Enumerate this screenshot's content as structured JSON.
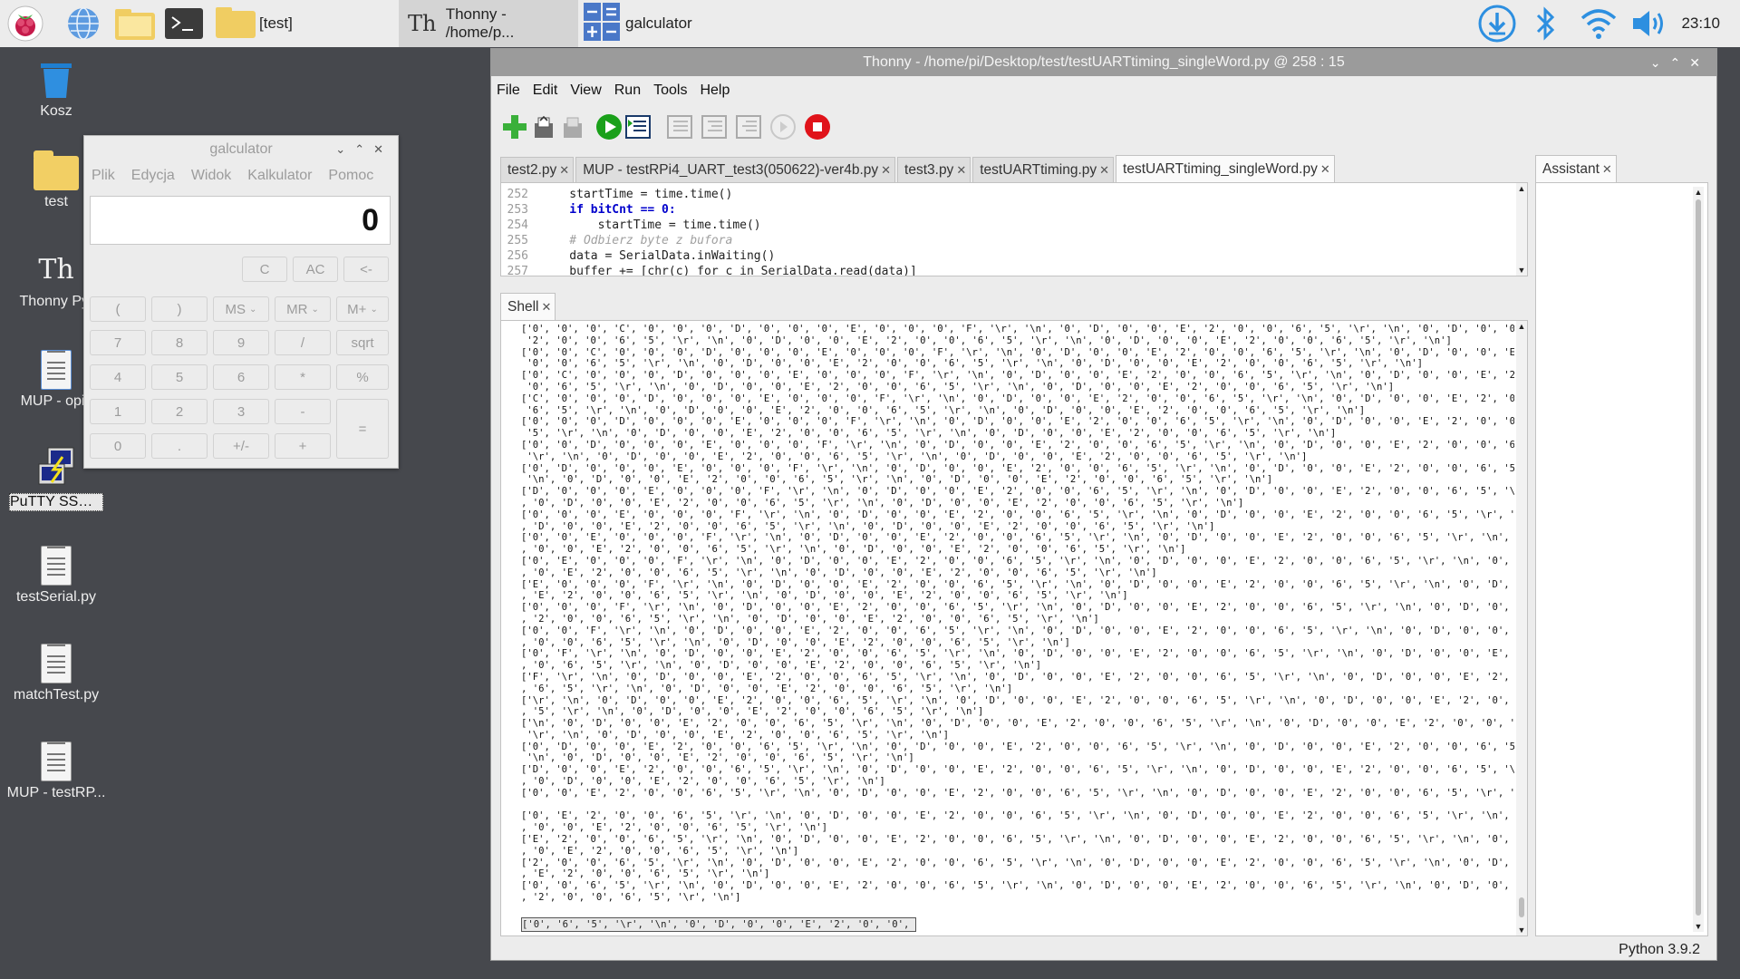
{
  "taskbar": {
    "tasks": [
      {
        "label": "[test]"
      },
      {
        "label": "Thonny  -  /home/p..."
      },
      {
        "label": "galculator"
      }
    ],
    "clock": "23:10",
    "icons": [
      "raspberry-menu-icon",
      "browser-globe-icon",
      "file-manager-icon",
      "terminal-icon",
      "folder-icon",
      "download-icon",
      "bluetooth-icon",
      "wifi-icon",
      "volume-icon"
    ]
  },
  "desktop": {
    "icons": [
      {
        "label": "Kosz",
        "icon": "trash-icon"
      },
      {
        "label": "test",
        "icon": "folder-icon"
      },
      {
        "label": "Thonny Pyt",
        "icon": "thonny-icon"
      },
      {
        "label": "MUP - opis",
        "icon": "document-icon"
      },
      {
        "label": "PuTTY SSH ...",
        "icon": "putty-icon"
      },
      {
        "label": "testSerial.py",
        "icon": "file-icon"
      },
      {
        "label": "matchTest.py",
        "icon": "file-icon"
      },
      {
        "label": "MUP - testRP...",
        "icon": "file-icon"
      }
    ]
  },
  "calculator": {
    "title": "galculator",
    "menu": [
      "Plik",
      "Edycja",
      "Widok",
      "Kalkulator",
      "Pomoc"
    ],
    "display": "0",
    "top_buttons": [
      "C",
      "AC",
      "<-"
    ],
    "rows": [
      [
        "(",
        ")",
        "MS",
        "MR",
        "M+"
      ],
      [
        "7",
        "8",
        "9",
        "/",
        "sqrt"
      ],
      [
        "4",
        "5",
        "6",
        "*",
        "%"
      ],
      [
        "1",
        "2",
        "3",
        "-",
        "="
      ],
      [
        "0",
        ".",
        "+/-",
        "+"
      ]
    ]
  },
  "thonny": {
    "title": "Thonny  -  /home/pi/Desktop/test/testUARTtiming_singleWord.py  @  258 : 15",
    "menu": [
      "File",
      "Edit",
      "View",
      "Run",
      "Tools",
      "Help"
    ],
    "toolbar": [
      "new-file",
      "open-file",
      "save-file",
      "run",
      "debug",
      "step-over",
      "step-into",
      "step-out",
      "resume",
      "stop"
    ],
    "editor_tabs": [
      {
        "label": "test2.py"
      },
      {
        "label": "MUP - testRPi4_UART_test3(050622)-ver4b.py"
      },
      {
        "label": "test3.py"
      },
      {
        "label": "testUARTtiming.py"
      },
      {
        "label": "testUARTtiming_singleWord.py",
        "active": true
      }
    ],
    "assistant_tab": "Assistant",
    "shell_tab": "Shell",
    "code": [
      {
        "n": "252",
        "text": "    startTime = time.time()"
      },
      {
        "n": "253",
        "text": "    if bitCnt == 0:"
      },
      {
        "n": "254",
        "text": "        startTime = time.time()"
      },
      {
        "n": "255",
        "text": "    # Odbierz byte z bufora"
      },
      {
        "n": "256",
        "text": "    data = SerialData.inWaiting()"
      },
      {
        "n": "257",
        "text": "    buffer += [chr(c) for c in SerialData.read(data)]"
      }
    ],
    "shell_lines": [
      "['0', '0', '0', 'C', '0', '0', '0', 'D', '0', '0', '0', 'E', '0', '0', '0', 'F', '\\r', '\\n', '0', 'D', '0', '0', 'E', '2', '0', '0', '6', '5', '\\r', '\\n', '0', 'D', '0', '0', 'E',",
      " '2', '0', '0', '6', '5', '\\r', '\\n', '0', 'D', '0', '0', 'E', '2', '0', '0', '6', '5', '\\r', '\\n', '0', 'D', '0', '0', 'E', '2', '0', '0', '6', '5', '\\r', '\\n']",
      "['0', '0', 'C', '0', '0', '0', 'D', '0', '0', '0', 'E', '0', '0', '0', 'F', '\\r', '\\n', '0', 'D', '0', '0', 'E', '2', '0', '0', '6', '5', '\\r', '\\n', '0', 'D', '0', '0', 'E', '2',",
      " '0', '0', '6', '5', '\\r', '\\n', '0', 'D', '0', '0', 'E', '2', '0', '0', '6', '5', '\\r', '\\n', '0', 'D', '0', '0', 'E', '2', '0', '0', '6', '5', '\\r', '\\n']",
      "['0', 'C', '0', '0', '0', 'D', '0', '0', '0', 'E', '0', '0', '0', 'F', '\\r', '\\n', '0', 'D', '0', '0', 'E', '2', '0', '0', '6', '5', '\\r', '\\n', '0', 'D', '0', '0', 'E', '2', '0',",
      " '0', '6', '5', '\\r', '\\n', '0', 'D', '0', '0', 'E', '2', '0', '0', '6', '5', '\\r', '\\n', '0', 'D', '0', '0', 'E', '2', '0', '0', '6', '5', '\\r', '\\n']",
      "['C', '0', '0', '0', 'D', '0', '0', '0', 'E', '0', '0', '0', 'F', '\\r', '\\n', '0', 'D', '0', '0', 'E', '2', '0', '0', '6', '5', '\\r', '\\n', '0', 'D', '0', '0', 'E', '2', '0', '0',",
      " '6', '5', '\\r', '\\n', '0', 'D', '0', '0', 'E', '2', '0', '0', '6', '5', '\\r', '\\n', '0', 'D', '0', '0', 'E', '2', '0', '0', '6', '5', '\\r', '\\n']",
      "['0', '0', '0', 'D', '0', '0', '0', 'E', '0', '0', '0', 'F', '\\r', '\\n', '0', 'D', '0', '0', 'E', '2', '0', '0', '6', '5', '\\r', '\\n', '0', 'D', '0', '0', 'E', '2', '0', '0', '6',",
      " '5', '\\r', '\\n', '0', 'D', '0', '0', 'E', '2', '0', '0', '6', '5', '\\r', '\\n', '0', 'D', '0', '0', 'E', '2', '0', '0', '6', '5', '\\r', '\\n']",
      "['0', '0', 'D', '0', '0', '0', 'E', '0', '0', '0', 'F', '\\r', '\\n', '0', 'D', '0', '0', 'E', '2', '0', '0', '6', '5', '\\r', '\\n', '0', 'D', '0', '0', 'E', '2', '0', '0', '6', '5',",
      " '\\r', '\\n', '0', 'D', '0', '0', 'E', '2', '0', '0', '6', '5', '\\r', '\\n', '0', 'D', '0', '0', 'E', '2', '0', '0', '6', '5', '\\r', '\\n']",
      "['0', 'D', '0', '0', '0', 'E', '0', '0', '0', 'F', '\\r', '\\n', '0', 'D', '0', '0', 'E', '2', '0', '0', '6', '5', '\\r', '\\n', '0', 'D', '0', '0', 'E', '2', '0', '0', '6', '5', '\\r',",
      " '\\n', '0', 'D', '0', '0', 'E', '2', '0', '0', '6', '5', '\\r', '\\n', '0', 'D', '0', '0', 'E', '2', '0', '0', '6', '5', '\\r', '\\n']",
      "['D', '0', '0', '0', 'E', '0', '0', '0', 'F', '\\r', '\\n', '0', 'D', '0', '0', 'E', '2', '0', '0', '6', '5', '\\r', '\\n', '0', 'D', '0', '0', 'E', '2', '0', '0', '6', '5', '\\r', '\\n'",
      ", '0', 'D', '0', '0', 'E', '2', '0', '0', '6', '5', '\\r', '\\n', '0', 'D', '0', '0', 'E', '2', '0', '0', '6', '5', '\\r', '\\n']",
      "['0', '0', '0', 'E', '0', '0', '0', 'F', '\\r', '\\n', '0', 'D', '0', '0', 'E', '2', '0', '0', '6', '5', '\\r', '\\n', '0', 'D', '0', '0', 'E', '2', '0', '0', '6', '5', '\\r', '\\n', '0'",
      ", 'D', '0', '0', 'E', '2', '0', '0', '6', '5', '\\r', '\\n', '0', 'D', '0', '0', 'E', '2', '0', '0', '6', '5', '\\r', '\\n']",
      "['0', '0', 'E', '0', '0', '0', 'F', '\\r', '\\n', '0', 'D', '0', '0', 'E', '2', '0', '0', '6', '5', '\\r', '\\n', '0', 'D', '0', '0', 'E', '2', '0', '0', '6', '5', '\\r', '\\n', '0', 'D'",
      ", '0', '0', 'E', '2', '0', '0', '6', '5', '\\r', '\\n', '0', 'D', '0', '0', 'E', '2', '0', '0', '6', '5', '\\r', '\\n']",
      "['0', 'E', '0', '0', '0', 'F', '\\r', '\\n', '0', 'D', '0', '0', 'E', '2', '0', '0', '6', '5', '\\r', '\\n', '0', 'D', '0', '0', 'E', '2', '0', '0', '6', '5', '\\r', '\\n', '0', 'D', '0'",
      ", '0', 'E', '2', '0', '0', '6', '5', '\\r', '\\n', '0', 'D', '0', '0', 'E', '2', '0', '0', '6', '5', '\\r', '\\n']",
      "['E', '0', '0', '0', 'F', '\\r', '\\n', '0', 'D', '0', '0', 'E', '2', '0', '0', '6', '5', '\\r', '\\n', '0', 'D', '0', '0', 'E', '2', '0', '0', '6', '5', '\\r', '\\n', '0', 'D', '0', '0'",
      ", 'E', '2', '0', '0', '6', '5', '\\r', '\\n', '0', 'D', '0', '0', 'E', '2', '0', '0', '6', '5', '\\r', '\\n']",
      "['0', '0', '0', 'F', '\\r', '\\n', '0', 'D', '0', '0', 'E', '2', '0', '0', '6', '5', '\\r', '\\n', '0', 'D', '0', '0', 'E', '2', '0', '0', '6', '5', '\\r', '\\n', '0', 'D', '0', '0', 'E'",
      ", '2', '0', '0', '6', '5', '\\r', '\\n', '0', 'D', '0', '0', 'E', '2', '0', '0', '6', '5', '\\r', '\\n']",
      "['0', '0', 'F', '\\r', '\\n', '0', 'D', '0', '0', 'E', '2', '0', '0', '6', '5', '\\r', '\\n', '0', 'D', '0', '0', 'E', '2', '0', '0', '6', '5', '\\r', '\\n', '0', 'D', '0', '0', 'E', '2'",
      ", '0', '0', '6', '5', '\\r', '\\n', '0', 'D', '0', '0', 'E', '2', '0', '0', '6', '5', '\\r', '\\n']",
      "['0', 'F', '\\r', '\\n', '0', 'D', '0', '0', 'E', '2', '0', '0', '6', '5', '\\r', '\\n', '0', 'D', '0', '0', 'E', '2', '0', '0', '6', '5', '\\r', '\\n', '0', 'D', '0', '0', 'E', '2', '0'",
      ", '0', '6', '5', '\\r', '\\n', '0', 'D', '0', '0', 'E', '2', '0', '0', '6', '5', '\\r', '\\n']",
      "['F', '\\r', '\\n', '0', 'D', '0', '0', 'E', '2', '0', '0', '6', '5', '\\r', '\\n', '0', 'D', '0', '0', 'E', '2', '0', '0', '6', '5', '\\r', '\\n', '0', 'D', '0', '0', 'E', '2', '0', '0'",
      ", '6', '5', '\\r', '\\n', '0', 'D', '0', '0', 'E', '2', '0', '0', '6', '5', '\\r', '\\n']",
      "['\\r', '\\n', '0', 'D', '0', '0', 'E', '2', '0', '0', '6', '5', '\\r', '\\n', '0', 'D', '0', '0', 'E', '2', '0', '0', '6', '5', '\\r', '\\n', '0', 'D', '0', '0', 'E', '2', '0', '0', '6'",
      ", '5', '\\r', '\\n', '0', 'D', '0', '0', 'E', '2', '0', '0', '6', '5', '\\r', '\\n']",
      "['\\n', '0', 'D', '0', '0', 'E', '2', '0', '0', '6', '5', '\\r', '\\n', '0', 'D', '0', '0', 'E', '2', '0', '0', '6', '5', '\\r', '\\n', '0', 'D', '0', '0', 'E', '2', '0', '0', '6', '5',",
      " '\\r', '\\n', '0', 'D', '0', '0', 'E', '2', '0', '0', '6', '5', '\\r', '\\n']",
      "['0', 'D', '0', '0', 'E', '2', '0', '0', '6', '5', '\\r', '\\n', '0', 'D', '0', '0', 'E', '2', '0', '0', '6', '5', '\\r', '\\n', '0', 'D', '0', '0', 'E', '2', '0', '0', '6', '5', '\\r',",
      " '\\n', '0', 'D', '0', '0', 'E', '2', '0', '0', '6', '5', '\\r', '\\n']",
      "['D', '0', '0', 'E', '2', '0', '0', '6', '5', '\\r', '\\n', '0', 'D', '0', '0', 'E', '2', '0', '0', '6', '5', '\\r', '\\n', '0', 'D', '0', '0', 'E', '2', '0', '0', '6', '5', '\\r', '\\n'",
      ", '0', 'D', '0', '0', 'E', '2', '0', '0', '6', '5', '\\r', '\\n']",
      "['0', '0', 'E', '2', '0', '0', '6', '5', '\\r', '\\n', '0', 'D', '0', '0', 'E', '2', '0', '0', '6', '5', '\\r', '\\n', '0', 'D', '0', '0', 'E', '2', '0', '0', '6', '5', '\\r', '\\n', '0'",
      "",
      "['0', 'E', '2', '0', '0', '6', '5', '\\r', '\\n', '0', 'D', '0', '0', 'E', '2', '0', '0', '6', '5', '\\r', '\\n', '0', 'D', '0', '0', 'E', '2', '0', '0', '6', '5', '\\r', '\\n', '0', 'D'",
      ", '0', '0', 'E', '2', '0', '0', '6', '5', '\\r', '\\n']",
      "['E', '2', '0', '0', '6', '5', '\\r', '\\n', '0', 'D', '0', '0', 'E', '2', '0', '0', '6', '5', '\\r', '\\n', '0', 'D', '0', '0', 'E', '2', '0', '0', '6', '5', '\\r', '\\n', '0', 'D', '0'",
      ", '0', 'E', '2', '0', '0', '6', '5', '\\r', '\\n']",
      "['2', '0', '0', '6', '5', '\\r', '\\n', '0', 'D', '0', '0', 'E', '2', '0', '0', '6', '5', '\\r', '\\n', '0', 'D', '0', '0', 'E', '2', '0', '0', '6', '5', '\\r', '\\n', '0', 'D', '0', '0'",
      ", 'E', '2', '0', '0', '6', '5', '\\r', '\\n']",
      "['0', '0', '6', '5', '\\r', '\\n', '0', 'D', '0', '0', 'E', '2', '0', '0', '6', '5', '\\r', '\\n', '0', 'D', '0', '0', 'E', '2', '0', '0', '6', '5', '\\r', '\\n', '0', 'D', '0', '0', 'E'",
      ", '2', '0', '0', '6', '5', '\\r', '\\n']"
    ],
    "shell_input": "['0', '6', '5', '\\r', '\\n', '0', 'D', '0', '0', 'E', '2', '0', '0', '6 ..",
    "status": "Python 3.9.2"
  }
}
